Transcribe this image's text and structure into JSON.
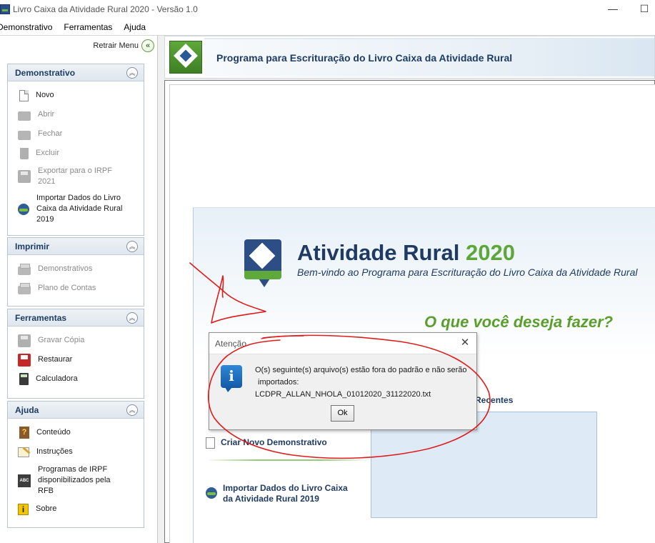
{
  "window": {
    "title": "Livro Caixa da Atividade Rural 2020 - Versão 1.0",
    "minimize": "—",
    "maximize": "☐"
  },
  "menu": {
    "items": [
      "Demonstrativo",
      "Ferramentas",
      "Ajuda"
    ]
  },
  "sidebar": {
    "retrair": "Retrair Menu",
    "retrair_icon": "«",
    "collapse_icon": "︽",
    "sections": [
      {
        "title": "Demonstrativo",
        "items": [
          {
            "label": "Novo",
            "icon": "new-document-icon",
            "enabled": true
          },
          {
            "label": "Abrir",
            "icon": "open-folder-icon",
            "enabled": false
          },
          {
            "label": "Fechar",
            "icon": "close-folder-icon",
            "enabled": false
          },
          {
            "label": "Excluir",
            "icon": "trash-icon",
            "enabled": false
          },
          {
            "label": "Exportar para o IRPF 2021",
            "icon": "export-icon",
            "enabled": false
          },
          {
            "label": "Importar Dados do Livro Caixa da Atividade Rural 2019",
            "icon": "rural-logo-icon",
            "enabled": true
          }
        ]
      },
      {
        "title": "Imprimir",
        "items": [
          {
            "label": "Demonstrativos",
            "icon": "printer-icon",
            "enabled": false
          },
          {
            "label": "Plano de Contas",
            "icon": "printer-icon",
            "enabled": false
          }
        ]
      },
      {
        "title": "Ferramentas",
        "items": [
          {
            "label": "Gravar Cópia",
            "icon": "save-icon",
            "enabled": false
          },
          {
            "label": "Restaurar",
            "icon": "restore-icon",
            "enabled": true
          },
          {
            "label": "Calculadora",
            "icon": "calculator-icon",
            "enabled": true
          }
        ]
      },
      {
        "title": "Ajuda",
        "items": [
          {
            "label": "Conteúdo",
            "icon": "help-book-icon",
            "enabled": true
          },
          {
            "label": "Instruções",
            "icon": "instructions-icon",
            "enabled": true
          },
          {
            "label": "Programas de IRPF disponibilizados pela RFB",
            "icon": "abc-icon",
            "enabled": true
          },
          {
            "label": "Sobre",
            "icon": "info-icon",
            "enabled": true
          }
        ]
      }
    ]
  },
  "header": {
    "title": "Programa para Escrituração do Livro Caixa da Atividade Rural"
  },
  "welcome": {
    "title_main": "Atividade Rural ",
    "title_year": "2020",
    "subtitle": "Bem-vindo ao Programa para Escrituração do Livro Caixa da Atividade Rural",
    "question": "O que você deseja fazer?",
    "recent_label": "s Recentes",
    "new_action": "Criar Novo Demonstrativo",
    "import_action_line1": "Importar Dados do Livro Caixa",
    "import_action_line2": "da Atividade Rural 2019"
  },
  "dialog": {
    "title": "Atenção",
    "close": "✕",
    "icon": "i",
    "line1": "O(s) seguinte(s) arquivo(s) estão fora do padrão e não serão",
    "line2": "importados:",
    "filename": "LCDPR_ALLAN_NHOLA_01012020_31122020.txt",
    "ok_label": "Ok"
  },
  "colors": {
    "accent_blue": "#1f3b63",
    "accent_green": "#5ca73a",
    "annotation_red": "#e01b1b"
  }
}
